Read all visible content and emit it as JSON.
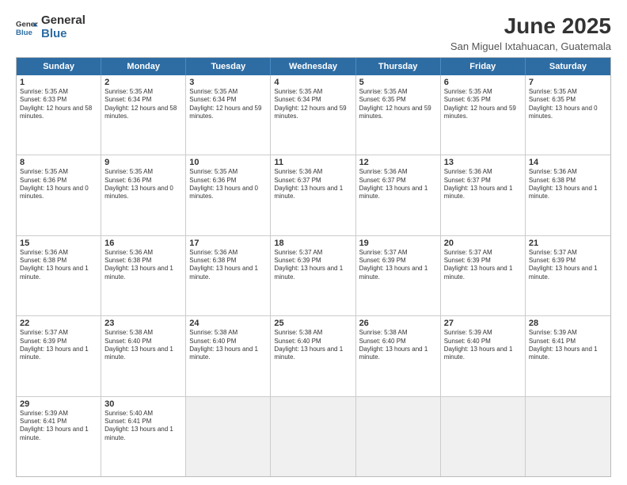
{
  "logo": {
    "general": "General",
    "blue": "Blue"
  },
  "title": "June 2025",
  "subtitle": "San Miguel Ixtahuacan, Guatemala",
  "headers": [
    "Sunday",
    "Monday",
    "Tuesday",
    "Wednesday",
    "Thursday",
    "Friday",
    "Saturday"
  ],
  "rows": [
    [
      {
        "day": "1",
        "rise": "5:35 AM",
        "set": "6:33 PM",
        "daylight": "12 hours and 58 minutes."
      },
      {
        "day": "2",
        "rise": "5:35 AM",
        "set": "6:34 PM",
        "daylight": "12 hours and 58 minutes."
      },
      {
        "day": "3",
        "rise": "5:35 AM",
        "set": "6:34 PM",
        "daylight": "12 hours and 59 minutes."
      },
      {
        "day": "4",
        "rise": "5:35 AM",
        "set": "6:34 PM",
        "daylight": "12 hours and 59 minutes."
      },
      {
        "day": "5",
        "rise": "5:35 AM",
        "set": "6:35 PM",
        "daylight": "12 hours and 59 minutes."
      },
      {
        "day": "6",
        "rise": "5:35 AM",
        "set": "6:35 PM",
        "daylight": "12 hours and 59 minutes."
      },
      {
        "day": "7",
        "rise": "5:35 AM",
        "set": "6:35 PM",
        "daylight": "13 hours and 0 minutes."
      }
    ],
    [
      {
        "day": "8",
        "rise": "5:35 AM",
        "set": "6:36 PM",
        "daylight": "13 hours and 0 minutes."
      },
      {
        "day": "9",
        "rise": "5:35 AM",
        "set": "6:36 PM",
        "daylight": "13 hours and 0 minutes."
      },
      {
        "day": "10",
        "rise": "5:35 AM",
        "set": "6:36 PM",
        "daylight": "13 hours and 0 minutes."
      },
      {
        "day": "11",
        "rise": "5:36 AM",
        "set": "6:37 PM",
        "daylight": "13 hours and 1 minute."
      },
      {
        "day": "12",
        "rise": "5:36 AM",
        "set": "6:37 PM",
        "daylight": "13 hours and 1 minute."
      },
      {
        "day": "13",
        "rise": "5:36 AM",
        "set": "6:37 PM",
        "daylight": "13 hours and 1 minute."
      },
      {
        "day": "14",
        "rise": "5:36 AM",
        "set": "6:38 PM",
        "daylight": "13 hours and 1 minute."
      }
    ],
    [
      {
        "day": "15",
        "rise": "5:36 AM",
        "set": "6:38 PM",
        "daylight": "13 hours and 1 minute."
      },
      {
        "day": "16",
        "rise": "5:36 AM",
        "set": "6:38 PM",
        "daylight": "13 hours and 1 minute."
      },
      {
        "day": "17",
        "rise": "5:36 AM",
        "set": "6:38 PM",
        "daylight": "13 hours and 1 minute."
      },
      {
        "day": "18",
        "rise": "5:37 AM",
        "set": "6:39 PM",
        "daylight": "13 hours and 1 minute."
      },
      {
        "day": "19",
        "rise": "5:37 AM",
        "set": "6:39 PM",
        "daylight": "13 hours and 1 minute."
      },
      {
        "day": "20",
        "rise": "5:37 AM",
        "set": "6:39 PM",
        "daylight": "13 hours and 1 minute."
      },
      {
        "day": "21",
        "rise": "5:37 AM",
        "set": "6:39 PM",
        "daylight": "13 hours and 1 minute."
      }
    ],
    [
      {
        "day": "22",
        "rise": "5:37 AM",
        "set": "6:39 PM",
        "daylight": "13 hours and 1 minute."
      },
      {
        "day": "23",
        "rise": "5:38 AM",
        "set": "6:40 PM",
        "daylight": "13 hours and 1 minute."
      },
      {
        "day": "24",
        "rise": "5:38 AM",
        "set": "6:40 PM",
        "daylight": "13 hours and 1 minute."
      },
      {
        "day": "25",
        "rise": "5:38 AM",
        "set": "6:40 PM",
        "daylight": "13 hours and 1 minute."
      },
      {
        "day": "26",
        "rise": "5:38 AM",
        "set": "6:40 PM",
        "daylight": "13 hours and 1 minute."
      },
      {
        "day": "27",
        "rise": "5:39 AM",
        "set": "6:40 PM",
        "daylight": "13 hours and 1 minute."
      },
      {
        "day": "28",
        "rise": "5:39 AM",
        "set": "6:41 PM",
        "daylight": "13 hours and 1 minute."
      }
    ],
    [
      {
        "day": "29",
        "rise": "5:39 AM",
        "set": "6:41 PM",
        "daylight": "13 hours and 1 minute."
      },
      {
        "day": "30",
        "rise": "5:40 AM",
        "set": "6:41 PM",
        "daylight": "13 hours and 1 minute."
      },
      null,
      null,
      null,
      null,
      null
    ]
  ]
}
